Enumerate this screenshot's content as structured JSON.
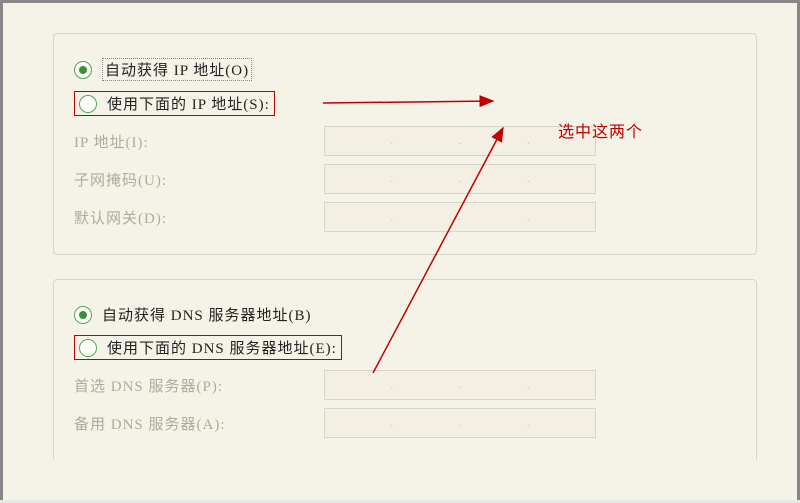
{
  "ip_group": {
    "auto_label": "自动获得 IP 地址(O)",
    "manual_label": "使用下面的 IP 地址(S):",
    "fields": {
      "ip": "IP 地址(I):",
      "mask": "子网掩码(U):",
      "gateway": "默认网关(D):"
    }
  },
  "dns_group": {
    "auto_label": "自动获得 DNS 服务器地址(B)",
    "manual_label": "使用下面的 DNS 服务器地址(E):",
    "fields": {
      "pref": "首选 DNS 服务器(P):",
      "alt": "备用 DNS 服务器(A):"
    }
  },
  "annotation": "选中这两个"
}
